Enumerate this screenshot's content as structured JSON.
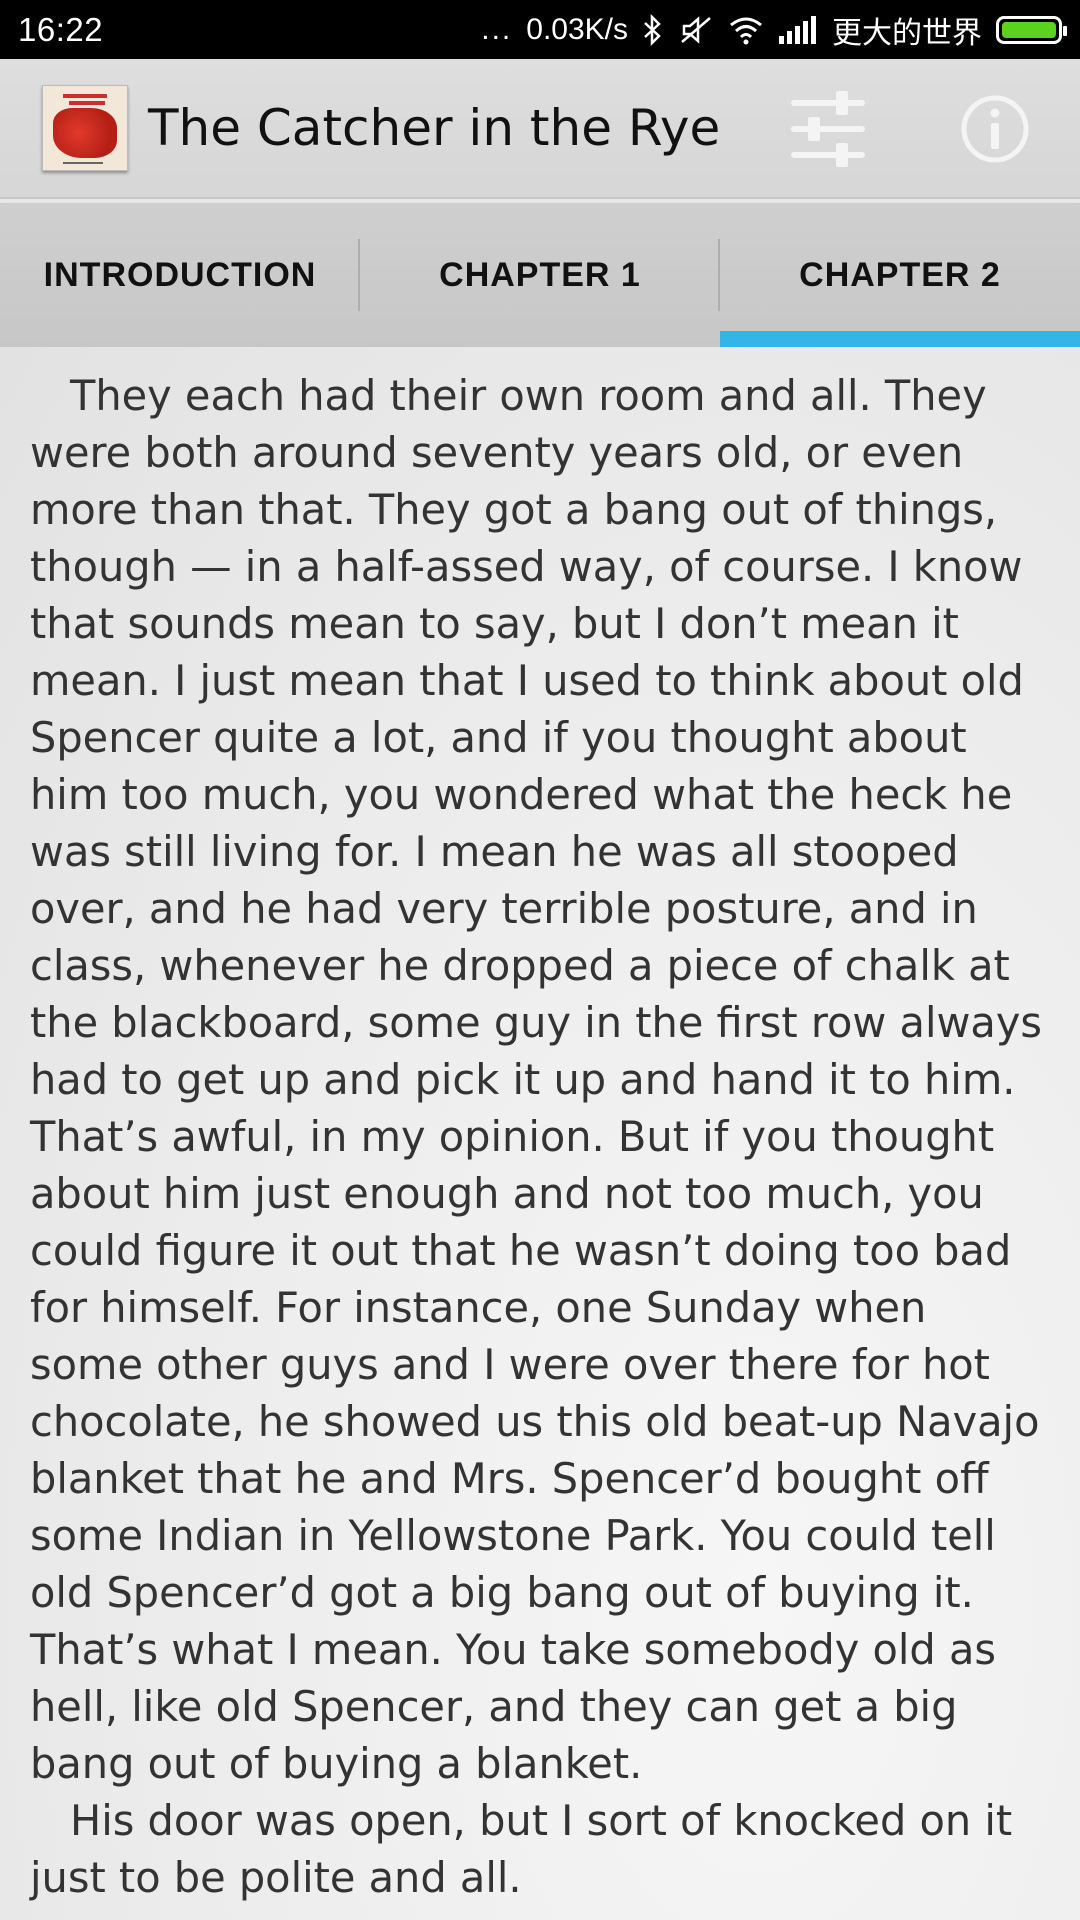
{
  "status_bar": {
    "time": "16:22",
    "dots": "...",
    "net_speed": "0.03K/s",
    "carrier": "更大的世界",
    "icons": [
      "bluetooth-icon",
      "mute-icon",
      "wifi-icon",
      "signal-icon",
      "battery-icon"
    ],
    "battery_color": "#5ad21e"
  },
  "app_bar": {
    "title": "The Catcher in the Rye",
    "icons": [
      "equalizer-icon",
      "info-icon"
    ]
  },
  "tabs": [
    {
      "label": "INTRODUCTION",
      "selected": false
    },
    {
      "label": "CHAPTER 1",
      "selected": false
    },
    {
      "label": "CHAPTER 2",
      "selected": true
    }
  ],
  "accent_color": "#33b5e5",
  "content": {
    "paragraphs": [
      "They each had their own room and all. They were both around seventy years old, or even more than that. They got a bang out of things, though — in a half-assed way, of course. I know that sounds mean to say, but I don’t mean it mean. I just mean that I used to think about old Spencer quite a lot, and if you thought about him too much, you wondered what the heck he was still living for. I mean he was all stooped over, and he had very terrible posture, and in class, whenever he dropped a piece of chalk at the blackboard, some guy in the first row always had to get up and pick it up and hand it to him. That’s awful, in my opinion. But if you thought about him just enough and not too much, you could figure it out that he wasn’t doing too bad for himself. For instance, one Sunday when some other guys and I were over there for hot chocolate, he showed us this old beat-up Navajo blanket that he and Mrs. Spencer’d bought off some Indian in Yellowstone Park. You could tell old Spencer’d got a big bang out of buying it. That’s what I mean. You take somebody old as hell, like old Spencer, and they can get a big bang out of buying a blanket.",
      "His door was open, but I sort of knocked on it just to be polite and all."
    ]
  }
}
